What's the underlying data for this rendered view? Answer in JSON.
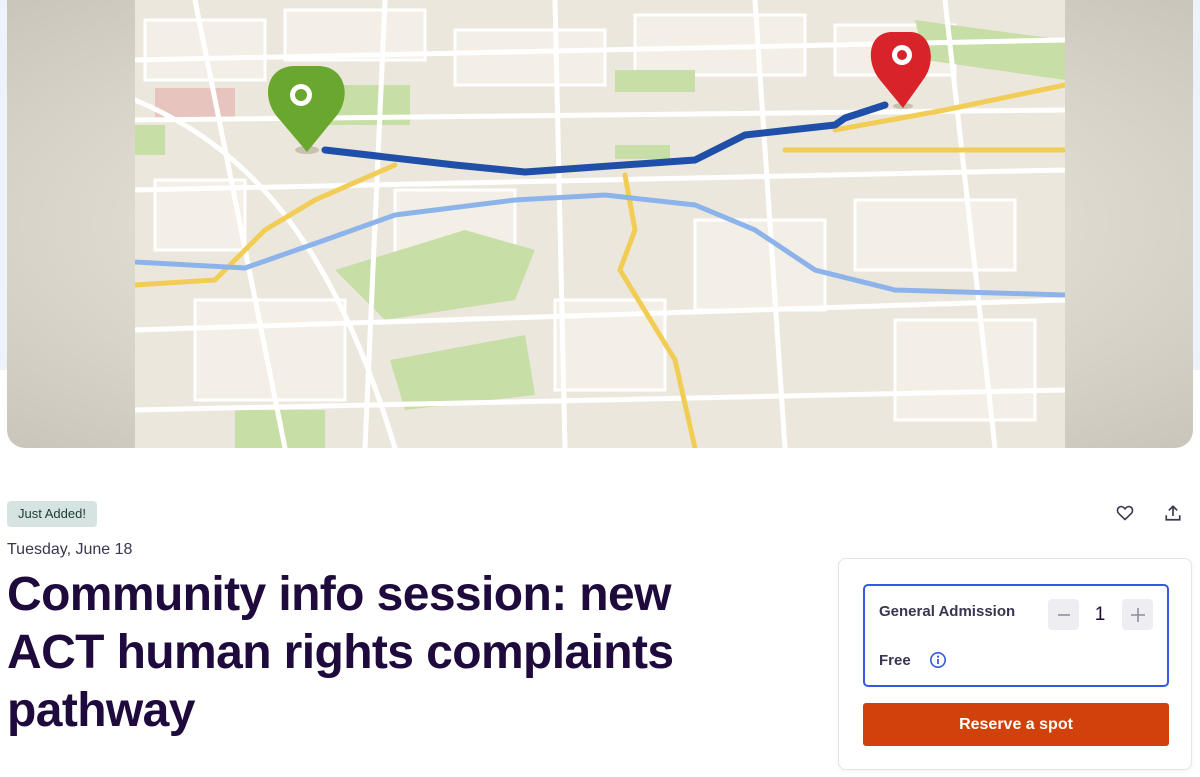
{
  "event": {
    "badge": "Just Added!",
    "date": "Tuesday, June 18",
    "title": "Community info session: new ACT human rights complaints pathway"
  },
  "actions": {
    "like_icon": "heart-icon",
    "share_icon": "share-upload-icon"
  },
  "ticket": {
    "name": "General Admission",
    "price": "Free",
    "quantity": "1",
    "info_icon": "info-icon",
    "minus_icon": "minus-icon",
    "plus_icon": "plus-icon",
    "reserve_label": "Reserve a spot"
  },
  "hero": {
    "image": "map-with-route",
    "start_pin_color": "#6aa72e",
    "end_pin_color": "#d9232a",
    "route_color": "#1f4fa8"
  },
  "colors": {
    "accent_orange": "#d1410c",
    "focus_blue": "#3659e3",
    "title_color": "#1e0a3c",
    "badge_bg": "#d6e4e1"
  }
}
